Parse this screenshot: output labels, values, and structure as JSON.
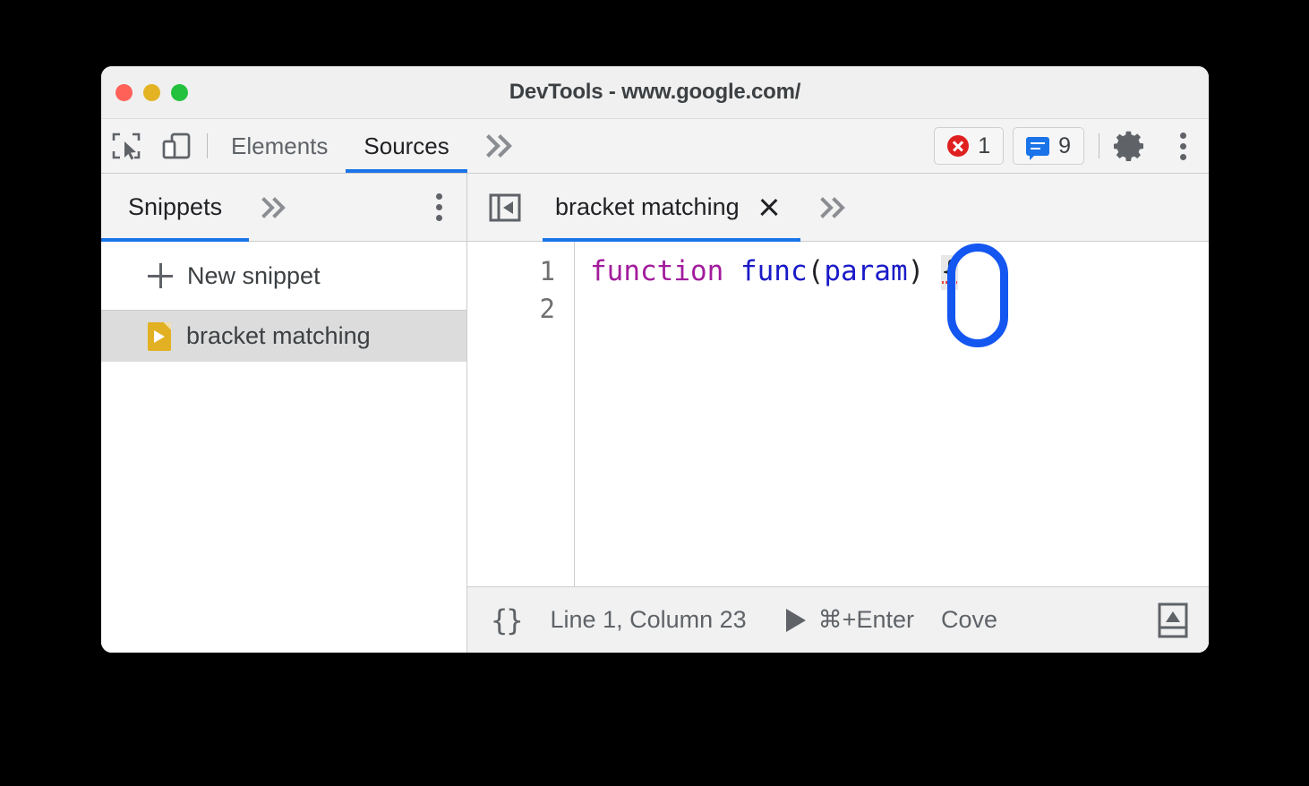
{
  "window": {
    "title": "DevTools - www.google.com/",
    "controls": [
      "close-button",
      "minimize-button",
      "maximize-button"
    ]
  },
  "toolbar": {
    "inspect_icon": "inspect-element-icon",
    "device_icon": "device-toolbar-icon",
    "tabs": [
      {
        "label": "Elements",
        "active": false
      },
      {
        "label": "Sources",
        "active": true
      }
    ],
    "overflow_label": "»",
    "error_badge": {
      "icon": "error-icon",
      "count": "1"
    },
    "message_badge": {
      "icon": "message-icon",
      "count": "9"
    },
    "settings_icon": "gear-icon",
    "menu_icon": "kebab-menu-icon"
  },
  "sidebar": {
    "tab_label": "Snippets",
    "overflow_label": "»",
    "menu_icon": "kebab-menu-icon",
    "new_snippet_label": "New snippet",
    "items": [
      {
        "label": "bracket matching",
        "icon": "snippet-file-icon",
        "selected": true
      }
    ]
  },
  "editor": {
    "collapse_icon": "collapse-sidebar-icon",
    "tab": {
      "label": "bracket matching",
      "close_icon": "close-icon"
    },
    "overflow_label": "»",
    "line_numbers": [
      "1",
      "2"
    ],
    "code_tokens": [
      {
        "text": "function",
        "type": "keyword"
      },
      {
        "text": " ",
        "type": "plain"
      },
      {
        "text": "func",
        "type": "function"
      },
      {
        "text": "(",
        "type": "punct"
      },
      {
        "text": "param",
        "type": "param"
      },
      {
        "text": ")",
        "type": "punct"
      },
      {
        "text": " ",
        "type": "plain"
      },
      {
        "text": "{",
        "type": "brace-highlight"
      }
    ],
    "code_line_1": "function func(param) {",
    "code_line_2": ""
  },
  "statusbar": {
    "pretty_print_label": "{}",
    "position_label": "Line 1, Column 23",
    "run_icon": "play-icon",
    "run_shortcut": "⌘+Enter",
    "coverage_label": "Cove",
    "drawer_icon": "drawer-toggle-icon"
  },
  "annotation": {
    "shape": "rounded-rect-highlight",
    "color": "#1456f0",
    "target": "opening-brace"
  },
  "colors": {
    "accent": "#1a73e8",
    "annotation": "#1456f0",
    "error": "#e02020",
    "snippet_icon": "#e2b023",
    "keyword": "#a21c9c",
    "identifier": "#1a1ac8",
    "squiggle": "#e8453c"
  }
}
